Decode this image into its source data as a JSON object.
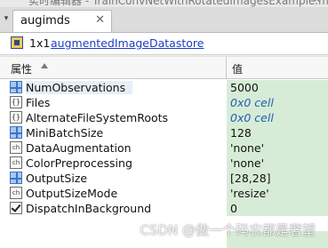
{
  "window": {
    "title": "实时编辑器 - TrainConvNetWithRotatedImagesExample.mlx"
  },
  "tab": {
    "label": "augimds"
  },
  "header": {
    "size": "1x1",
    "class_link": "augmentedImageDatastore"
  },
  "table": {
    "columns": {
      "name": "属性",
      "value": "值"
    },
    "rows": [
      {
        "name": "NumObservations",
        "value": "5000",
        "icon": "numeric-grid-icon"
      },
      {
        "name": "Files",
        "value": "0x0 cell",
        "icon": "cell-array-icon"
      },
      {
        "name": "AlternateFileSystemRoots",
        "value": "0x0 cell",
        "icon": "cell-array-icon"
      },
      {
        "name": "MiniBatchSize",
        "value": "128",
        "icon": "numeric-grid-icon"
      },
      {
        "name": "DataAugmentation",
        "value": "'none'",
        "icon": "char-array-icon"
      },
      {
        "name": "ColorPreprocessing",
        "value": "'none'",
        "icon": "char-array-icon"
      },
      {
        "name": "OutputSize",
        "value": "[28,28]",
        "icon": "numeric-grid-icon"
      },
      {
        "name": "OutputSizeMode",
        "value": "'resize'",
        "icon": "char-array-icon"
      },
      {
        "name": "DispatchInBackground",
        "value": "0",
        "icon": "logical-check-icon"
      }
    ]
  },
  "watermark": "CSDN @做一个码农都是奢望",
  "colors": {
    "value_bg": "#d7ecd7",
    "link": "#1a3ec8",
    "cell_value": "#1f5eb3"
  }
}
